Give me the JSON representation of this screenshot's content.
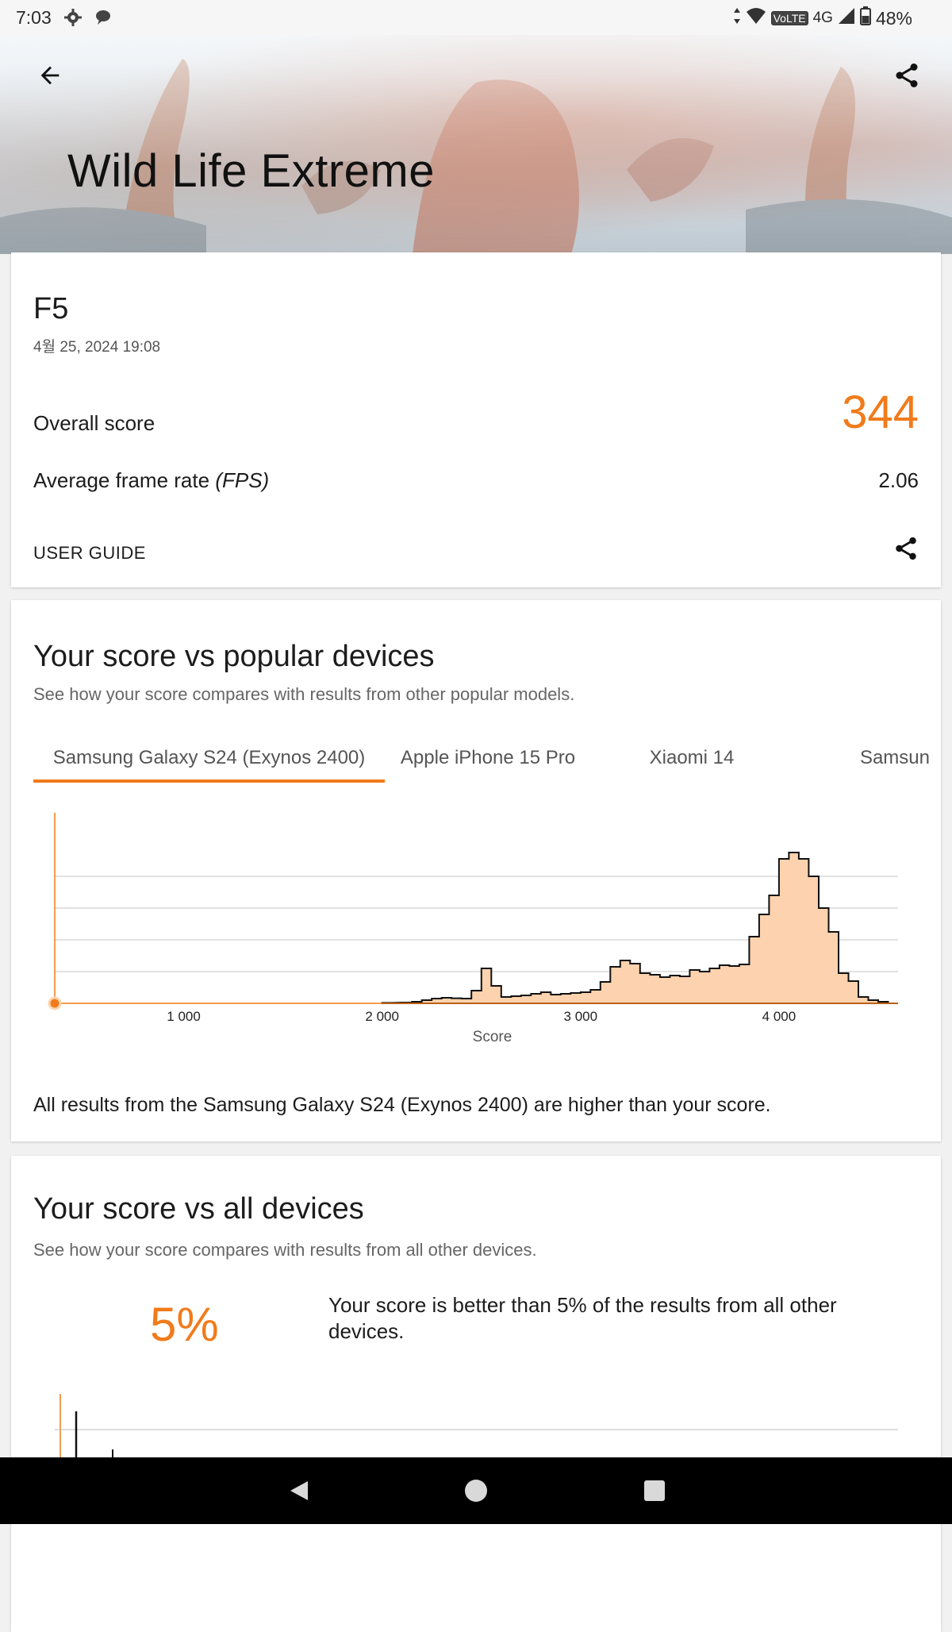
{
  "status": {
    "time": "7:03",
    "network": "4G",
    "volte": "VoLTE",
    "battery": "48%"
  },
  "header": {
    "title": "Wild Life Extreme"
  },
  "result": {
    "device": "F5",
    "date": "4월 25, 2024 19:08",
    "overall_label": "Overall score",
    "overall_score": "344",
    "fps_label": "Average frame rate",
    "fps_unit": "(FPS)",
    "fps_value": "2.06",
    "user_guide": "USER GUIDE"
  },
  "popular": {
    "title": "Your score vs popular devices",
    "subtitle": "See how your score compares with results from other popular models.",
    "tabs": [
      "Samsung Galaxy S24 (Exynos 2400)",
      "Apple iPhone 15 Pro",
      "Xiaomi 14",
      "Samsun"
    ],
    "active_tab": 0,
    "note": "All results from the Samsung Galaxy S24 (Exynos 2400) are higher than your score."
  },
  "all_devices": {
    "title": "Your score vs all devices",
    "subtitle": "See how your score compares with results from all other devices.",
    "percent": "5%",
    "description": "Your score is better than 5% of the results from all other devices."
  },
  "chart_data": {
    "type": "area",
    "xlabel": "Score",
    "ylabel": "",
    "x_ticks": [
      "1 000",
      "2 000",
      "3 000",
      "4 000"
    ],
    "xlim": [
      350,
      4600
    ],
    "user_score": 344,
    "accent_color": "#f17b1a",
    "fill_color": "#fdd2ae",
    "x": [
      2000,
      2100,
      2150,
      2200,
      2250,
      2300,
      2350,
      2400,
      2450,
      2500,
      2550,
      2600,
      2650,
      2700,
      2750,
      2800,
      2850,
      2900,
      2950,
      3000,
      3050,
      3100,
      3150,
      3200,
      3250,
      3300,
      3350,
      3400,
      3450,
      3500,
      3550,
      3600,
      3650,
      3700,
      3750,
      3800,
      3850,
      3900,
      3950,
      4000,
      4050,
      4100,
      4150,
      4200,
      4250,
      4300,
      4350,
      4400,
      4450,
      4500,
      4550
    ],
    "values": [
      0.3,
      0.5,
      1.0,
      2.0,
      3.0,
      3.5,
      3.2,
      3.0,
      8.0,
      22.0,
      11.0,
      4.0,
      4.5,
      5.0,
      6.0,
      7.0,
      5.5,
      6.0,
      6.5,
      7.0,
      8.5,
      13.5,
      23.0,
      27.0,
      25.0,
      19.0,
      18.0,
      16.5,
      17.5,
      17.0,
      21.0,
      20.0,
      22.0,
      24.0,
      23.5,
      24.5,
      42.0,
      56.0,
      68.0,
      91.0,
      95.0,
      91.0,
      80.0,
      60.0,
      45.0,
      19.0,
      14.0,
      4.0,
      2.0,
      1.0,
      0.0
    ],
    "ylim": [
      0,
      100
    ]
  },
  "chart_all": {
    "type": "area",
    "x_fraction_of_peak": "partial view"
  }
}
